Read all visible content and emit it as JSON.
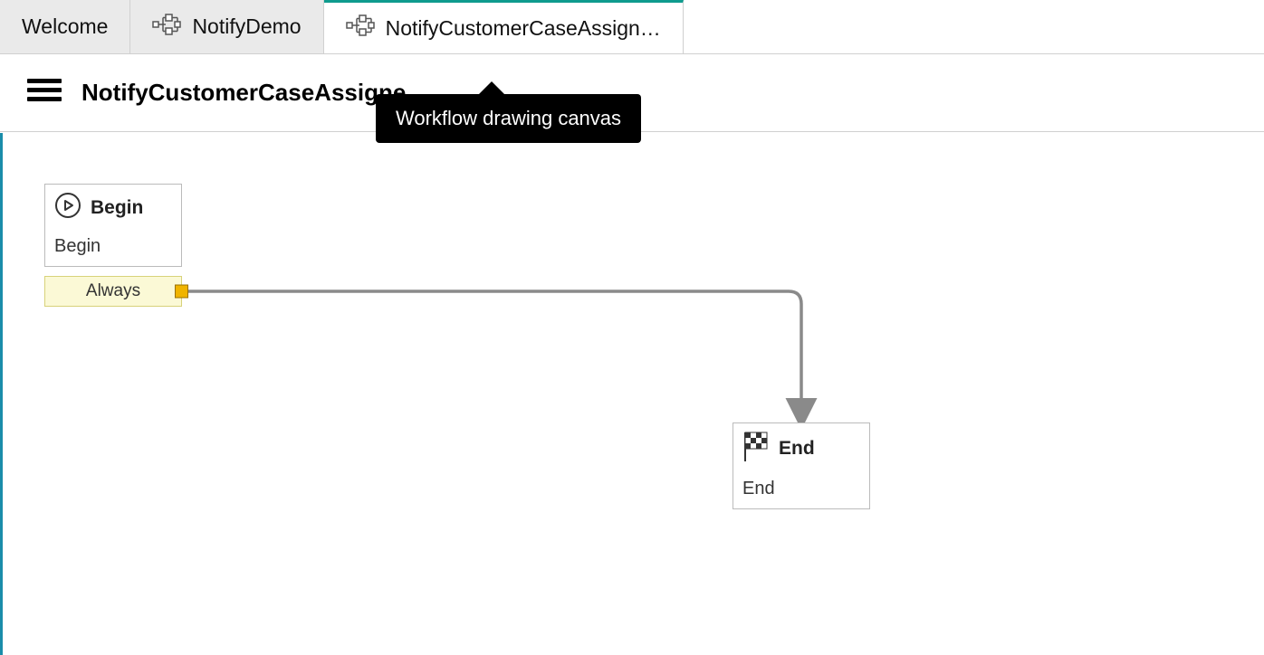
{
  "tabs": [
    {
      "label": "Welcome",
      "has_icon": false
    },
    {
      "label": "NotifyDemo",
      "has_icon": true
    },
    {
      "label": "NotifyCustomerCaseAssign…",
      "has_icon": true
    }
  ],
  "header": {
    "title": "NotifyCustomerCaseAssigne"
  },
  "tooltip": {
    "text": "Workflow drawing canvas"
  },
  "nodes": {
    "begin": {
      "title": "Begin",
      "subtitle": "Begin"
    },
    "end": {
      "title": "End",
      "subtitle": "End"
    }
  },
  "branch": {
    "label": "Always"
  }
}
